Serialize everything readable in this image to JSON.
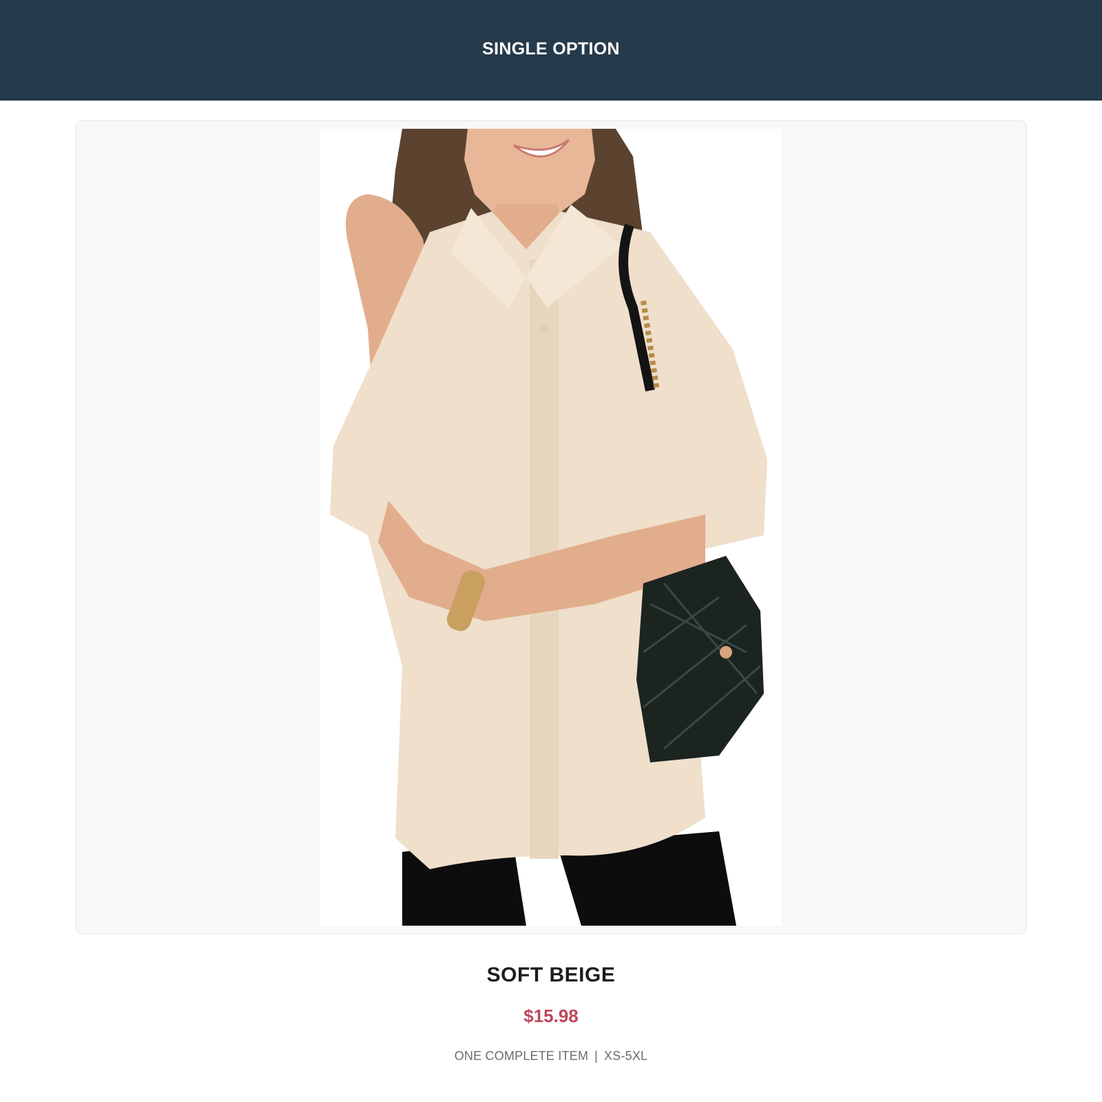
{
  "header": {
    "title": "SINGLE OPTION",
    "background_color": "#253a4a"
  },
  "product": {
    "image_description_icon": "product-photo",
    "name": "SOFT BEIGE",
    "price": "$15.98",
    "price_color": "#c0465a",
    "meta": {
      "items": "ONE COMPLETE ITEM",
      "separator": "|",
      "sizes": "XS-5XL"
    }
  }
}
